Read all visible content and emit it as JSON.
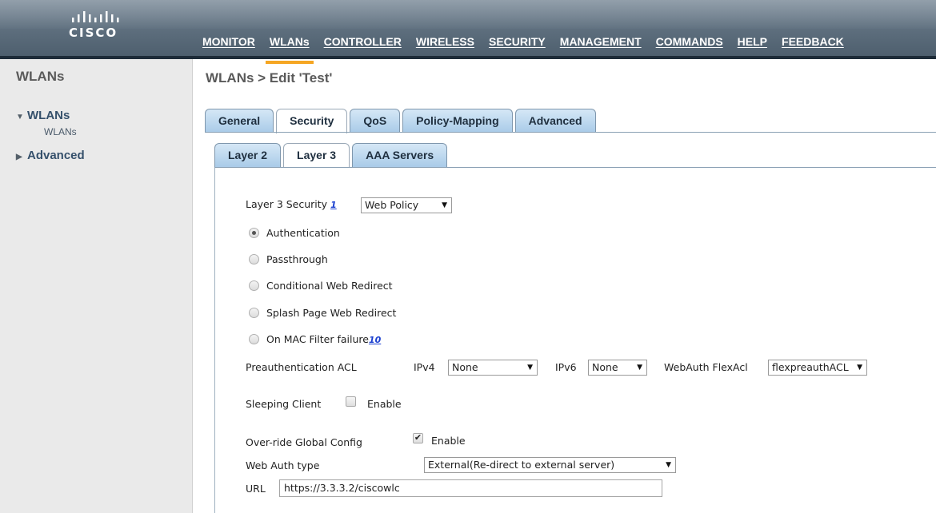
{
  "header": {
    "logo_text": "CISCO",
    "nav": [
      "MONITOR",
      "WLANs",
      "CONTROLLER",
      "WIRELESS",
      "SECURITY",
      "MANAGEMENT",
      "COMMANDS",
      "HELP",
      "FEEDBACK"
    ],
    "active_nav": "WLANs",
    "accent_color": "#f5a623"
  },
  "sidebar": {
    "title": "WLANs",
    "groups": [
      {
        "label": "WLANs",
        "expanded": true,
        "children": [
          "WLANs"
        ]
      },
      {
        "label": "Advanced",
        "expanded": false
      }
    ]
  },
  "main": {
    "breadcrumb": "WLANs > Edit  'Test'",
    "tabs": [
      "General",
      "Security",
      "QoS",
      "Policy-Mapping",
      "Advanced"
    ],
    "active_tab": "Security",
    "subtabs": [
      "Layer 2",
      "Layer 3",
      "AAA Servers"
    ],
    "active_subtab": "Layer 3",
    "layer3": {
      "security_label": "Layer 3 Security",
      "security_note": "1",
      "security_value": "Web Policy",
      "options": [
        {
          "label": "Authentication",
          "selected": true
        },
        {
          "label": "Passthrough",
          "selected": false
        },
        {
          "label": "Conditional Web Redirect",
          "selected": false
        },
        {
          "label": "Splash Page Web Redirect",
          "selected": false
        },
        {
          "label": "On MAC Filter failure",
          "selected": false,
          "note": "10"
        }
      ],
      "preauth_label": "Preauthentication ACL",
      "ipv4_label": "IPv4",
      "ipv4_value": "None",
      "ipv6_label": "IPv6",
      "ipv6_value": "None",
      "flexacl_label": "WebAuth FlexAcl",
      "flexacl_value": "flexpreauthACL",
      "sleeping_label": "Sleeping Client",
      "sleeping_enable": "Enable",
      "sleeping_checked": false,
      "override_label": "Over-ride Global Config",
      "override_enable": "Enable",
      "override_checked": true,
      "webauth_type_label": "Web Auth type",
      "webauth_type_value": "External(Re-direct to external server)",
      "url_label": "URL",
      "url_value": "https://3.3.3.2/ciscowlc"
    }
  }
}
